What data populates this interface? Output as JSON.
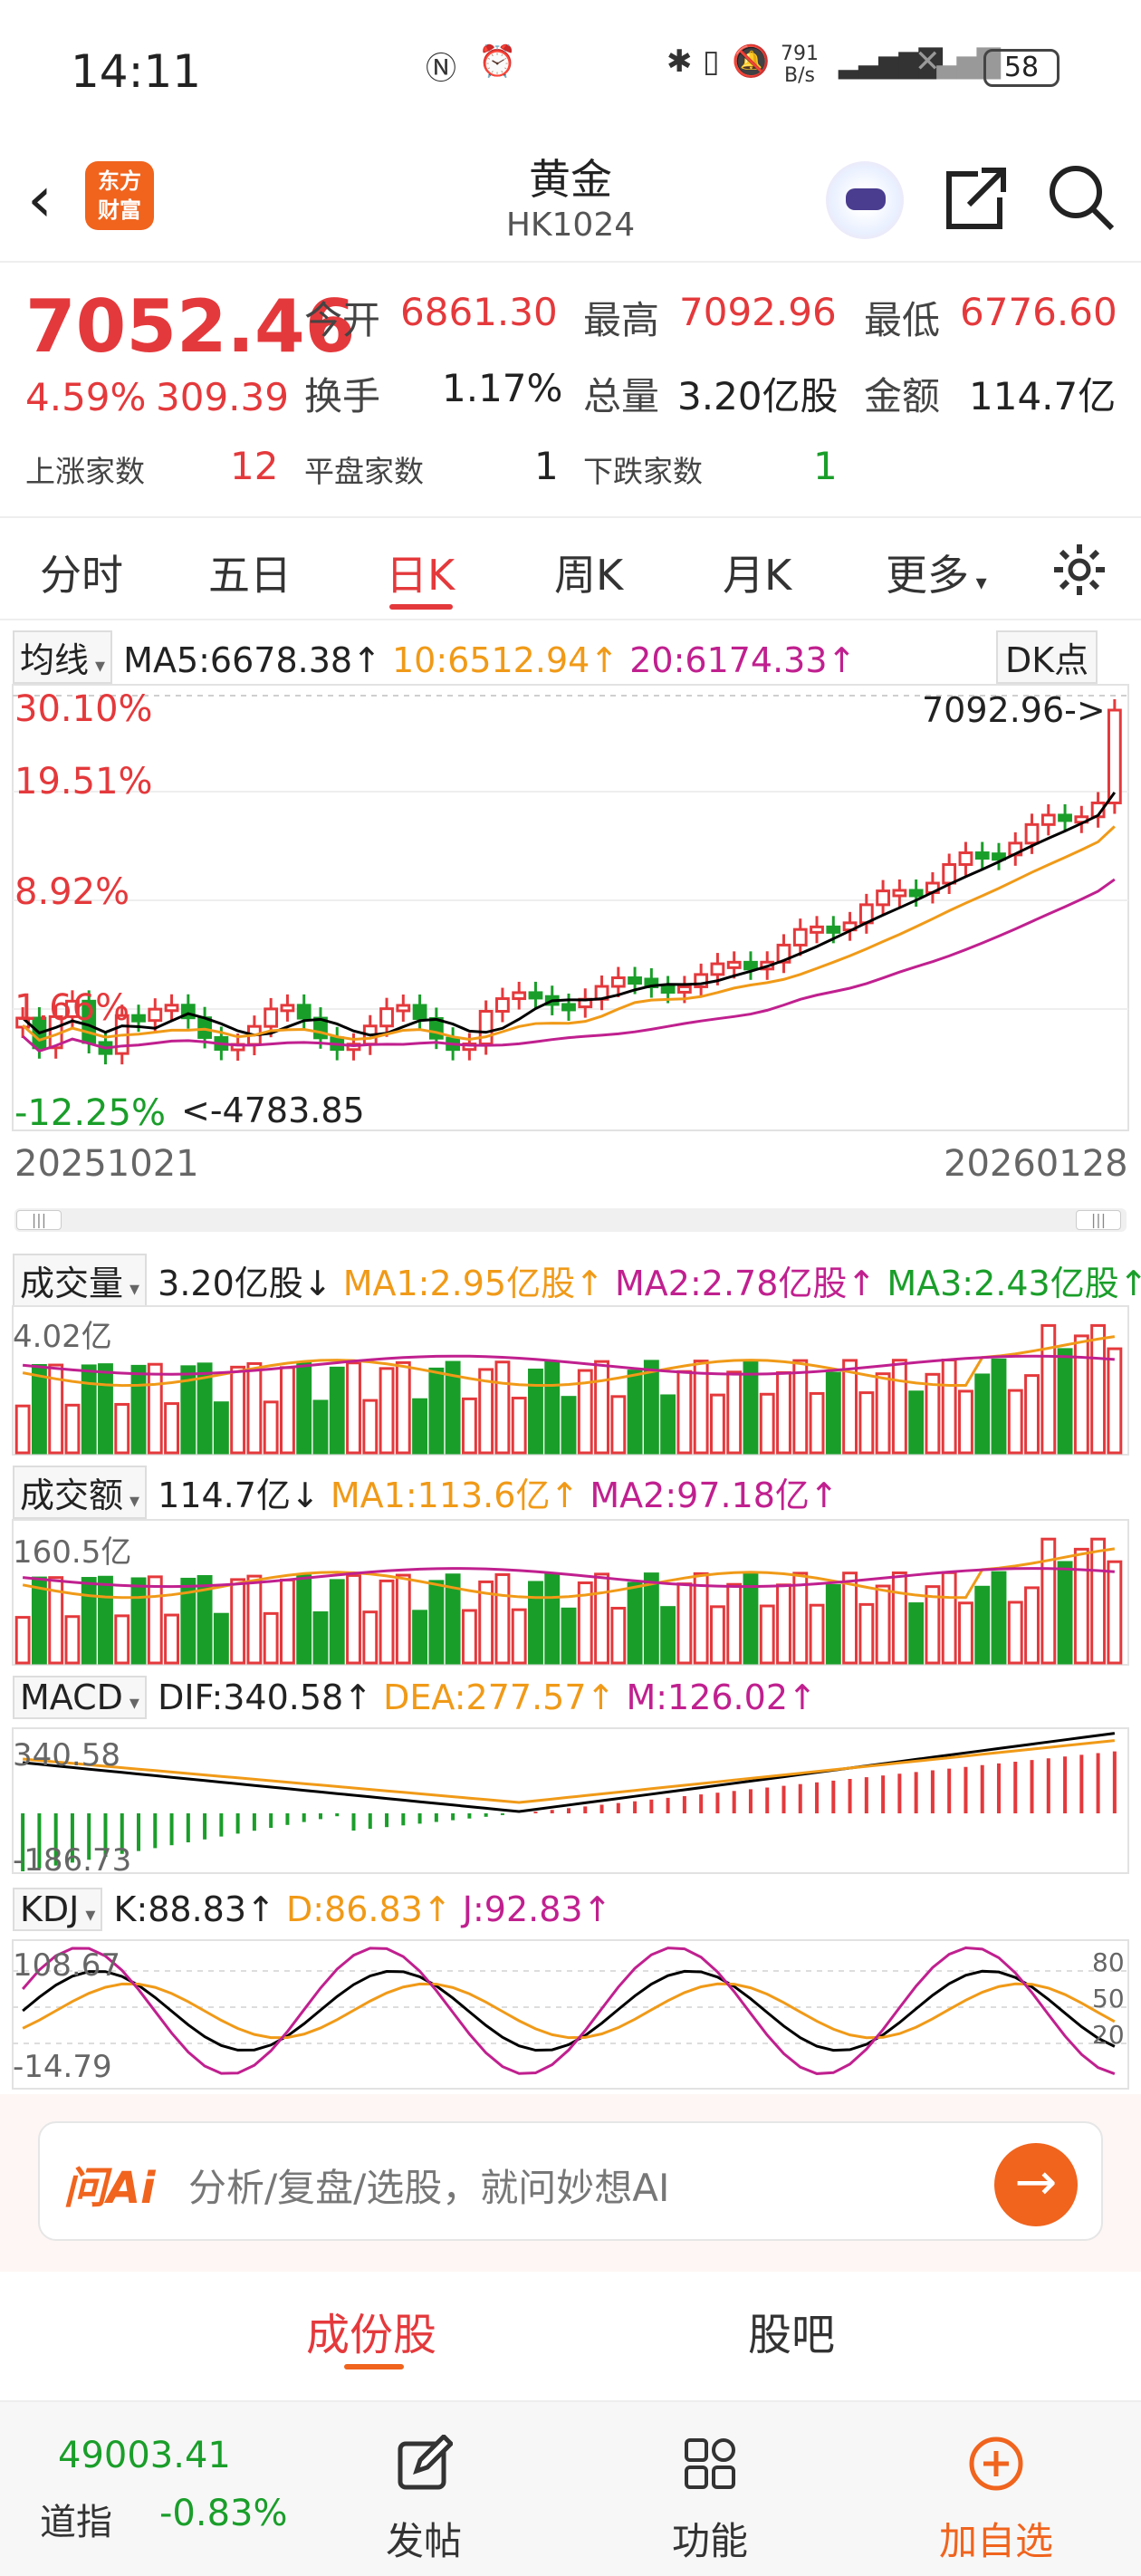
{
  "status": {
    "time": "14:11",
    "speed_top": "791",
    "speed_bot": "B/s",
    "battery": "58"
  },
  "header": {
    "title": "黄金",
    "code": "HK1024",
    "logo_line1": "东方",
    "logo_line2": "财富"
  },
  "quote": {
    "price": "7052.46",
    "change_pct": "4.59%",
    "change": "309.39",
    "open_label": "今开",
    "open": "6861.30",
    "high_label": "最高",
    "high": "7092.96",
    "low_label": "最低",
    "low": "6776.60",
    "turnover_label": "换手",
    "turnover": "1.17%",
    "volume_label": "总量",
    "volume": "3.20亿股",
    "amount_label": "金额",
    "amount": "114.7亿",
    "up_label": "上涨家数",
    "up": "12",
    "flat_label": "平盘家数",
    "flat": "1",
    "down_label": "下跌家数",
    "down": "1"
  },
  "tabs": [
    "分时",
    "五日",
    "日K",
    "周K",
    "月K",
    "更多"
  ],
  "ma": {
    "dropdown": "均线",
    "ma5": "MA5:6678.38↑",
    "ma10": "10:6512.94↑",
    "ma20": "20:6174.33↑",
    "dk": "DK点"
  },
  "kchart": {
    "pct_labels": [
      "30.10%",
      "19.51%",
      "8.92%",
      "1.66%",
      "-12.25%"
    ],
    "high_marker": "7092.96->",
    "low_marker": "<-4783.85",
    "date_start": "20251021",
    "date_end": "20260128"
  },
  "vol": {
    "dropdown": "成交量",
    "value": "3.20亿股↓",
    "ma1": "MA1:2.95亿股↑",
    "ma2": "MA2:2.78亿股↑",
    "ma3": "MA3:2.43亿股↑",
    "max": "4.02亿"
  },
  "amt": {
    "dropdown": "成交额",
    "value": "114.7亿↓",
    "ma1": "MA1:113.6亿↑",
    "ma2": "MA2:97.18亿↑",
    "max": "160.5亿"
  },
  "macd": {
    "dropdown": "MACD",
    "dif": "DIF:340.58↑",
    "dea": "DEA:277.57↑",
    "m": "M:126.02↑",
    "top": "340.58",
    "bottom": "-186.73"
  },
  "kdj": {
    "dropdown": "KDJ",
    "k": "K:88.83↑",
    "d": "D:86.83↑",
    "j": "J:92.83↑",
    "top": "108.67",
    "bottom": "-14.79",
    "l80": "80",
    "l50": "50",
    "l20": "20"
  },
  "ai": {
    "logo": "问Ai",
    "placeholder": "分析/复盘/选股，就问妙想AI"
  },
  "bottom_tabs": [
    "成份股",
    "股吧"
  ],
  "footer": {
    "index_value": "49003.41",
    "index_name": "道指",
    "index_change": "-0.83%",
    "post": "发帖",
    "func": "功能",
    "add": "加自选"
  },
  "colors": {
    "red": "#e4393c",
    "green": "#1a9e2a",
    "orange": "#f0641e",
    "ma5": "#000000",
    "ma10": "#f09a18",
    "ma20": "#c0208f"
  }
}
